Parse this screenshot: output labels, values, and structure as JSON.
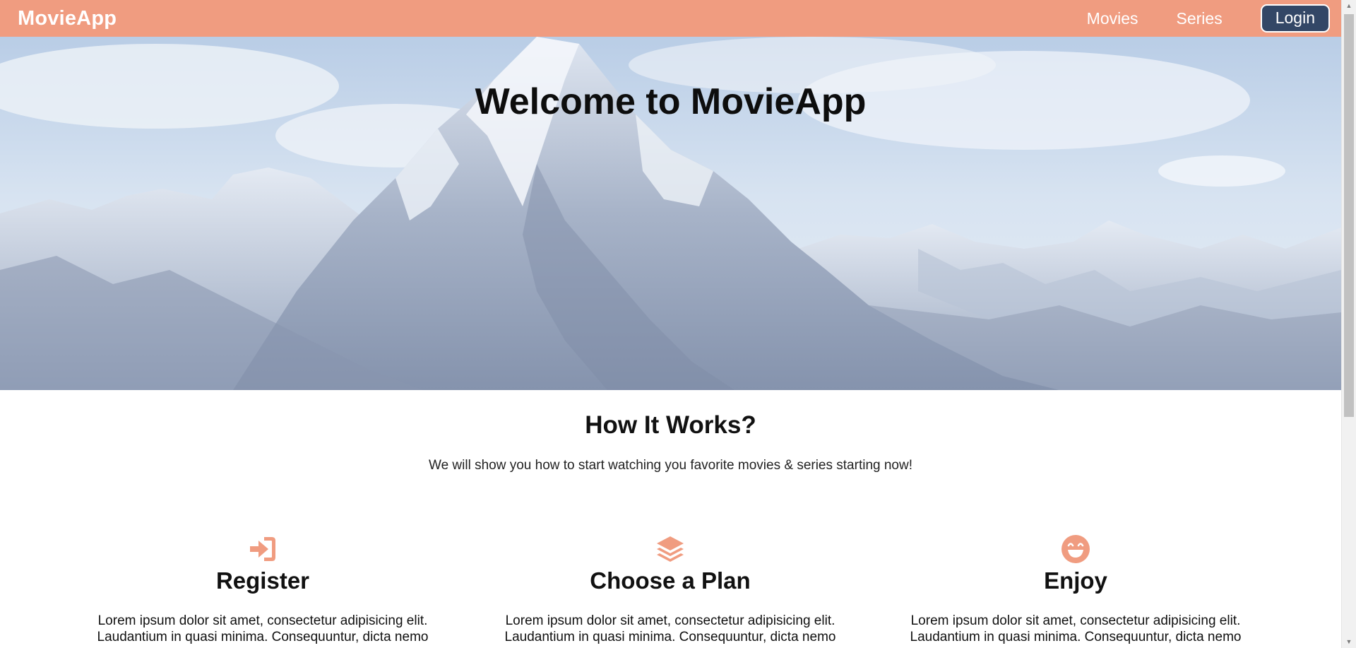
{
  "colors": {
    "navbar_bg": "#f09c80",
    "accent": "#f09c80",
    "login_bg": "#334766"
  },
  "navbar": {
    "brand": "MovieApp",
    "links": [
      "Movies",
      "Series"
    ],
    "login_label": "Login"
  },
  "hero": {
    "title": "Welcome to MovieApp"
  },
  "how_it_works": {
    "title": "How It Works?",
    "subtitle": "We will show you how to start watching you favorite movies & series starting now!",
    "steps": [
      {
        "icon": "sign-in-icon",
        "title": "Register",
        "text": "Lorem ipsum dolor sit amet, consectetur adipisicing elit. Laudantium in quasi minima. Consequuntur, dicta nemo"
      },
      {
        "icon": "layers-icon",
        "title": "Choose a Plan",
        "text": "Lorem ipsum dolor sit amet, consectetur adipisicing elit. Laudantium in quasi minima. Consequuntur, dicta nemo"
      },
      {
        "icon": "grin-icon",
        "title": "Enjoy",
        "text": "Lorem ipsum dolor sit amet, consectetur adipisicing elit. Laudantium in quasi minima. Consequuntur, dicta nemo"
      }
    ]
  }
}
